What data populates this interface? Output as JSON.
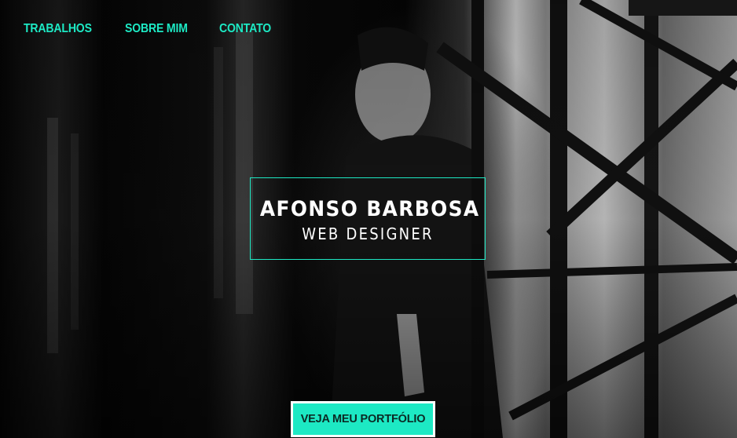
{
  "nav": {
    "items": [
      {
        "label": "TRABALHOS"
      },
      {
        "label": "SOBRE MIM"
      },
      {
        "label": "CONTATO"
      }
    ]
  },
  "hero": {
    "name": "AFONSO BARBOSA",
    "role": "WEB DESIGNER",
    "cta_label": "VEJA MEU PORTFÓLIO"
  },
  "colors": {
    "accent": "#1de9c4",
    "text": "#ffffff",
    "background": "#000000"
  }
}
